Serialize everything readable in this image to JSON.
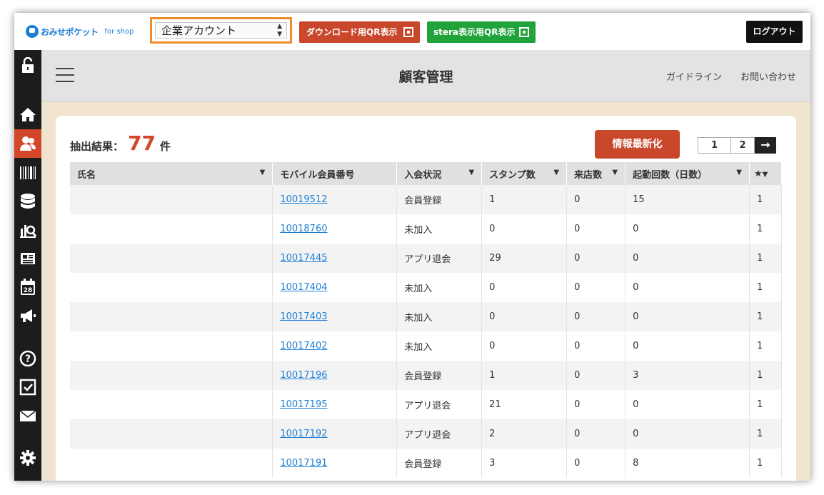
{
  "topbar": {
    "logo_text": "おみせポケット",
    "logo_sub": "for shop",
    "account_select": "企業アカウント",
    "download_qr_label": "ダウンロード用QR表示",
    "stera_qr_label": "stera表示用QR表示",
    "logout_label": "ログアウト"
  },
  "header": {
    "title": "顧客管理",
    "links": [
      "ガイドライン",
      "お問い合わせ"
    ]
  },
  "main": {
    "result_label": "抽出結果：",
    "result_count": "77",
    "result_unit": "件",
    "refresh_label": "情報最新化",
    "pager": {
      "page1": "1",
      "page2": "2",
      "next": "→"
    }
  },
  "table": {
    "headers": [
      "氏名",
      "モバイル会員番号",
      "入会状況",
      "スタンプ数",
      "来店数",
      "起動回数（日数）",
      "★"
    ],
    "rows": [
      [
        "",
        "10019512",
        "会員登録",
        "1",
        "0",
        "15",
        "1"
      ],
      [
        "",
        "10018760",
        "未加入",
        "0",
        "0",
        "0",
        "1"
      ],
      [
        "",
        "10017445",
        "アプリ退会",
        "29",
        "0",
        "0",
        "1"
      ],
      [
        "",
        "10017404",
        "未加入",
        "0",
        "0",
        "0",
        "1"
      ],
      [
        "",
        "10017403",
        "未加入",
        "0",
        "0",
        "0",
        "1"
      ],
      [
        "",
        "10017402",
        "未加入",
        "0",
        "0",
        "0",
        "1"
      ],
      [
        "",
        "10017196",
        "会員登録",
        "1",
        "0",
        "3",
        "1"
      ],
      [
        "",
        "10017195",
        "アプリ退会",
        "21",
        "0",
        "0",
        "1"
      ],
      [
        "",
        "10017192",
        "アプリ退会",
        "2",
        "0",
        "0",
        "1"
      ],
      [
        "",
        "10017191",
        "会員登録",
        "3",
        "0",
        "8",
        "1"
      ]
    ]
  },
  "sidebar": {
    "icons": [
      "unlock-icon",
      "home-icon",
      "users-icon",
      "barcode-icon",
      "database-icon",
      "analytics-icon",
      "news-icon",
      "calendar-icon",
      "megaphone-icon",
      "help-icon",
      "checkbox-icon",
      "mail-icon",
      "gear-icon"
    ],
    "calendar_day": "28",
    "active": "users-icon"
  },
  "colors": {
    "accent": "#d2472a",
    "link": "#1e7fd6",
    "green": "#20a33a",
    "orange_border": "#f08a2c"
  }
}
